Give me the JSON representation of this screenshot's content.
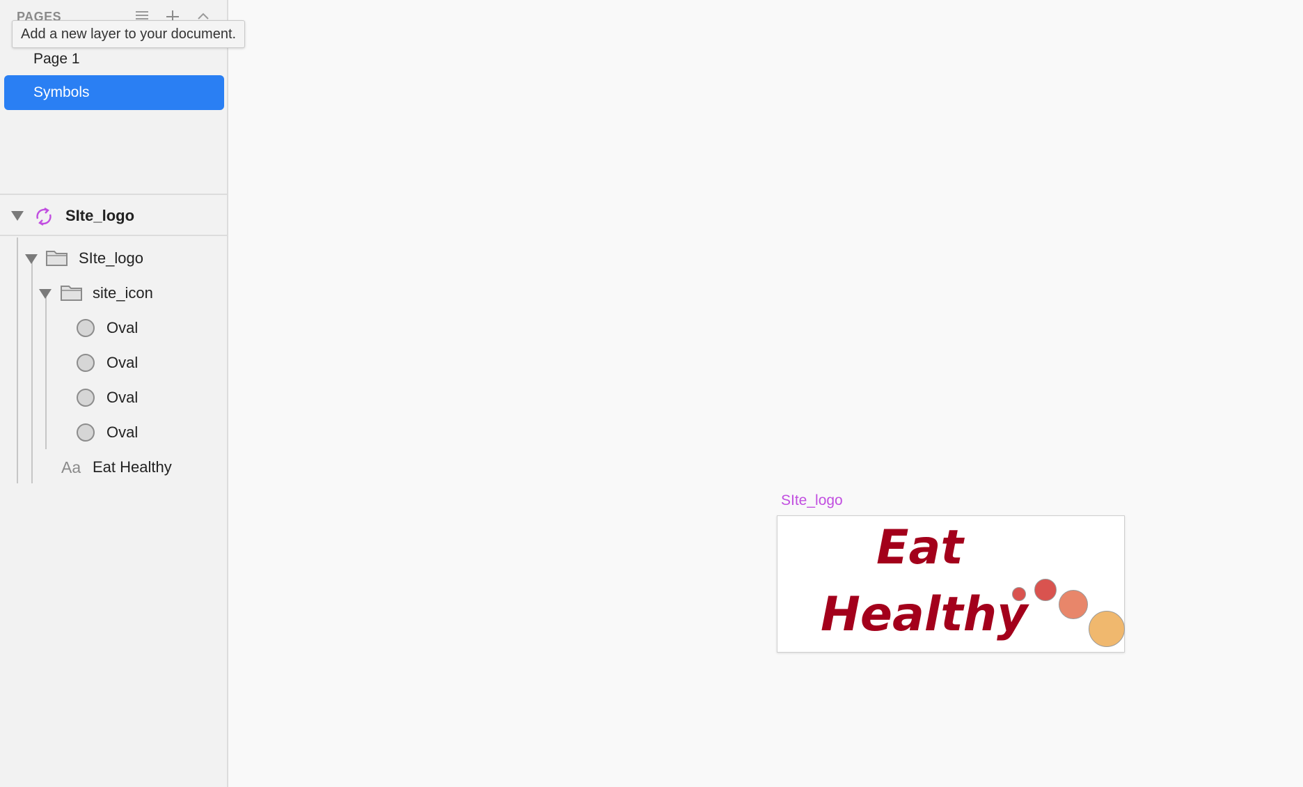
{
  "sidebar": {
    "pages_header": "PAGES",
    "tooltip": "Add a new layer to your document.",
    "pages": [
      {
        "label": "Page 1",
        "selected": false
      },
      {
        "label": "Symbols",
        "selected": true
      }
    ],
    "symbol_header": {
      "label": "SIte_logo",
      "icon": "symbol-sync-icon"
    },
    "layers": [
      {
        "label": "SIte_logo",
        "icon": "folder-icon"
      },
      {
        "label": "site_icon",
        "icon": "folder-icon"
      },
      {
        "label": "Oval",
        "icon": "oval-icon"
      },
      {
        "label": "Oval",
        "icon": "oval-icon"
      },
      {
        "label": "Oval",
        "icon": "oval-icon"
      },
      {
        "label": "Oval",
        "icon": "oval-icon"
      },
      {
        "label": "Eat Healthy",
        "icon": "text-layer-icon"
      }
    ],
    "text_icon_glyph": "Aa"
  },
  "canvas": {
    "artboard_label": "SIte_logo",
    "logo_line1": "Eat",
    "logo_line2": "Healthy",
    "colors": {
      "logo_text": "#a3001b",
      "dot_small": "#d9534f",
      "dot_medium": "#d9534f",
      "dot_large": "#e8866a",
      "dot_xlarge": "#f0b86e",
      "selection": "#2a7ff3",
      "symbol_accent": "#c14fe0"
    }
  }
}
